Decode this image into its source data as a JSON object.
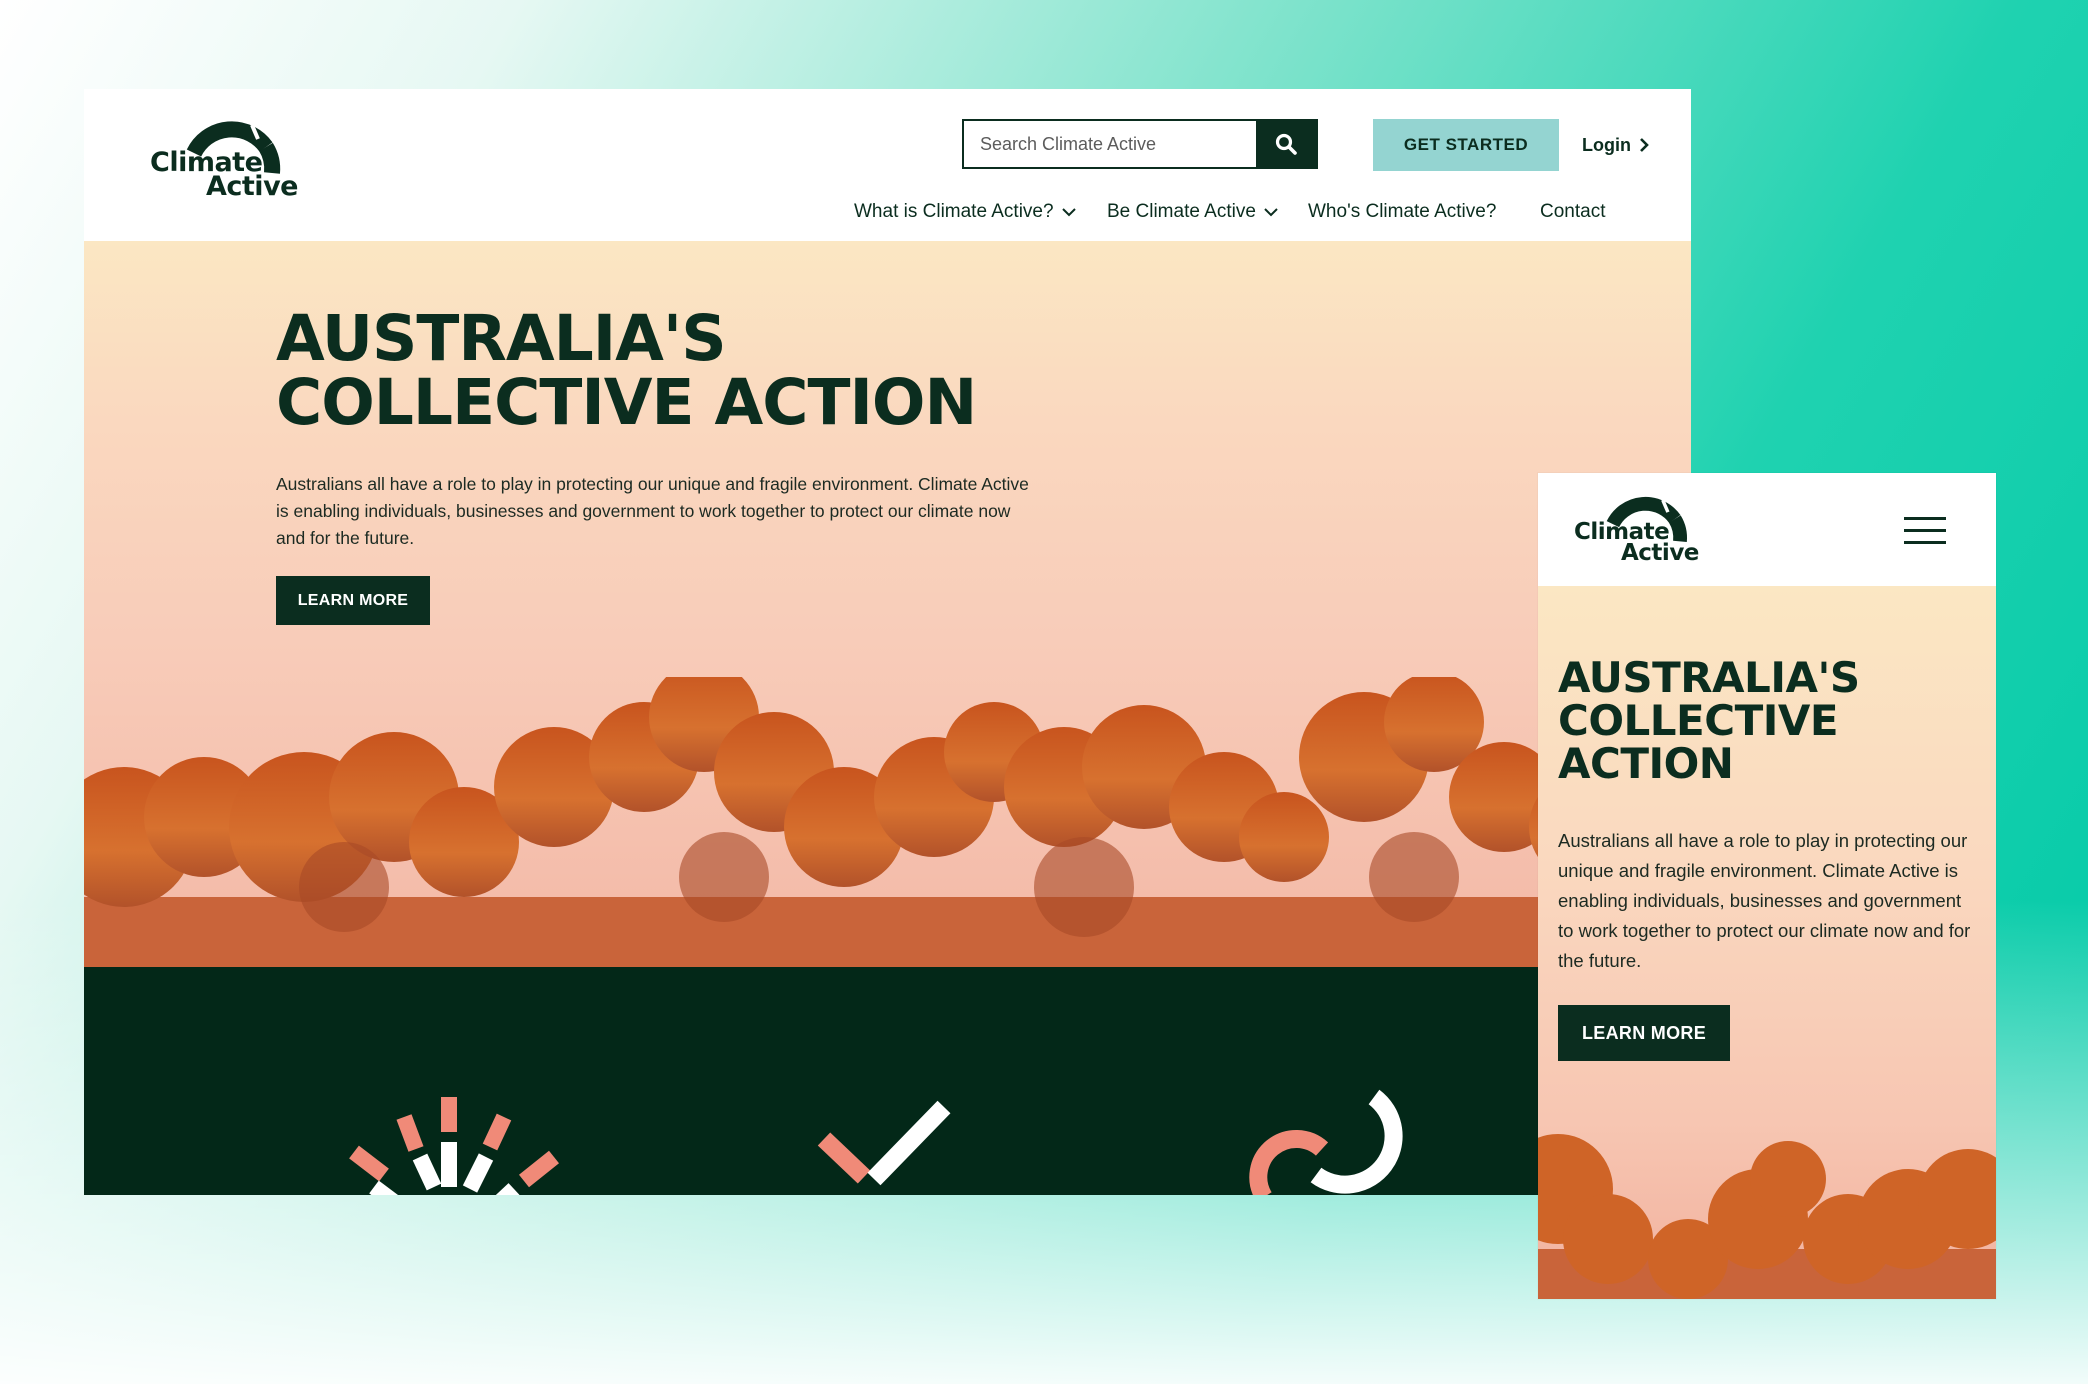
{
  "desktop": {
    "logo": {
      "line1": "Climate",
      "line2": "Active"
    },
    "search": {
      "placeholder": "Search Climate Active"
    },
    "header": {
      "get_started_label": "GET STARTED",
      "login_label": "Login"
    },
    "nav": [
      {
        "label": "What is Climate Active?",
        "has_dropdown": true
      },
      {
        "label": "Be Climate Active",
        "has_dropdown": true
      },
      {
        "label": "Who's Climate Active?",
        "has_dropdown": false
      },
      {
        "label": "Contact",
        "has_dropdown": false
      }
    ],
    "hero": {
      "title_line1": "AUSTRALIA'S",
      "title_line2": "COLLECTIVE ACTION",
      "body": "Australians all have a role to play in protecting our unique and fragile environment. Climate Active is enabling individuals, businesses and government to work together to protect our climate now and for the future.",
      "button_label": "LEARN MORE"
    },
    "band_icons": [
      "sunburst-icon",
      "checkmark-icon",
      "loop-icon"
    ]
  },
  "mobile": {
    "logo": {
      "line1": "Climate",
      "line2": "Active"
    },
    "hero": {
      "title_line1": "AUSTRALIA'S",
      "title_line2": "COLLECTIVE",
      "title_line3": "ACTION",
      "body": "Australians all have a role to play in protecting our unique and fragile environment. Climate Active is enabling individuals, businesses and government to work together to protect our climate now and for the future.",
      "button_label": "LEARN MORE"
    }
  },
  "colors": {
    "brand_dark": "#0b2d1f",
    "band_dark": "#032818",
    "accent_teal": "#94d4d1",
    "accent_coral": "#ee8a74",
    "background_green": "#00c9a7"
  }
}
